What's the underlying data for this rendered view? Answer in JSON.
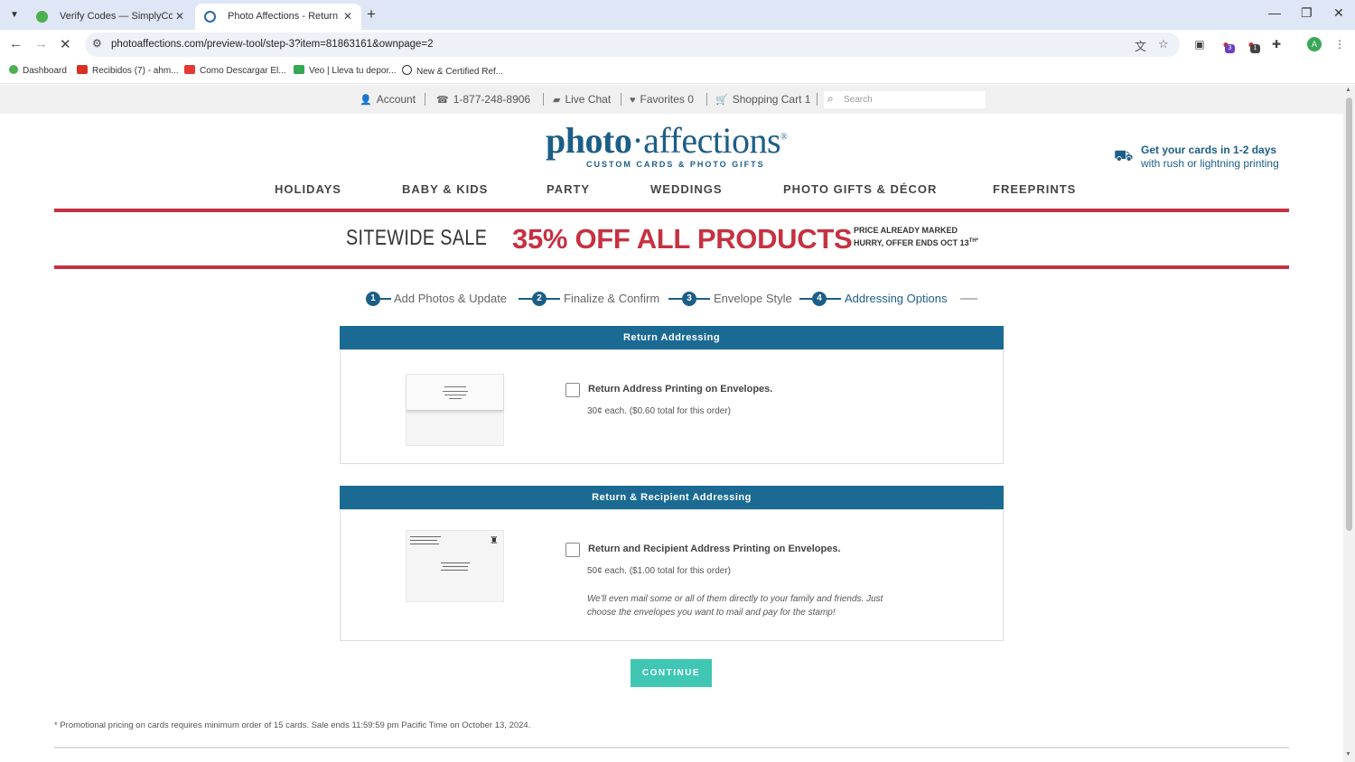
{
  "browser": {
    "tabs": [
      {
        "title": "Verify Codes — SimplyCodes",
        "favicon_color": "#4caf50"
      },
      {
        "title": "Photo Affections - Return Addr",
        "favicon_color": "#2d6a9f"
      }
    ],
    "url": "photoaffections.com/preview-tool/step-3?item=81863161&ownpage=2",
    "bookmarks": [
      {
        "label": "Dashboard",
        "color": "#4caf50"
      },
      {
        "label": "Recibidos (7) - ahm...",
        "color": "#d93025"
      },
      {
        "label": "Como Descargar El...",
        "color": "#e53935"
      },
      {
        "label": "Veo | Lleva tu depor...",
        "color": "#34a853"
      },
      {
        "label": "New & Certified Ref...",
        "color": "#333333"
      }
    ],
    "ext_badges": [
      "3",
      "1"
    ],
    "profile_initial": "A"
  },
  "utility": {
    "account": "Account",
    "phone": "1-877-248-8906",
    "chat": "Live Chat",
    "favorites": "Favorites 0",
    "cart": "Shopping Cart 1",
    "search_placeholder": "Search"
  },
  "header": {
    "logo_bold": "photo",
    "logo_dot": "·",
    "logo_rest": "affections",
    "logo_mark": "®",
    "tagline": "CUSTOM CARDS & PHOTO GIFTS",
    "shipping_title": "Get your cards in 1-2 days",
    "shipping_sub": "with rush or lightning printing"
  },
  "nav": [
    "HOLIDAYS",
    "BABY & KIDS",
    "PARTY",
    "WEDDINGS",
    "PHOTO GIFTS & DÉCOR",
    "FREEPRINTS"
  ],
  "sale": {
    "left": "SITEWIDE SALE",
    "main": "35% OFF ALL PRODUCTS",
    "right1": "PRICE ALREADY MARKED",
    "right2": "HURRY, OFFER ENDS OCT 13",
    "right2_sup": "TH*"
  },
  "steps": [
    {
      "num": "1",
      "label": "Add Photos & Update"
    },
    {
      "num": "2",
      "label": "Finalize & Confirm"
    },
    {
      "num": "3",
      "label": "Envelope Style"
    },
    {
      "num": "4",
      "label": "Addressing Options"
    }
  ],
  "return_panel": {
    "title": "Return Addressing",
    "option": "Return Address Printing on Envelopes.",
    "price": "30¢ each. ($0.60 total for this order)"
  },
  "recipient_panel": {
    "title": "Return & Recipient Addressing",
    "option": "Return and Recipient Address Printing on Envelopes.",
    "price": "50¢ each. ($1.00 total for this order)",
    "note": "We'll even mail some or all of them directly to your family and friends. Just choose the envelopes you want to mail and pay for the stamp!"
  },
  "continue_label": "CONTINUE",
  "footnote": "* Promotional pricing on cards requires minimum order of 15 cards. Sale ends 11:59:59 pm Pacific Time on October 13, 2024.",
  "colors": {
    "brand_blue": "#1b5e87",
    "sale_red": "#c63141",
    "continue_teal": "#3fc7b3"
  }
}
